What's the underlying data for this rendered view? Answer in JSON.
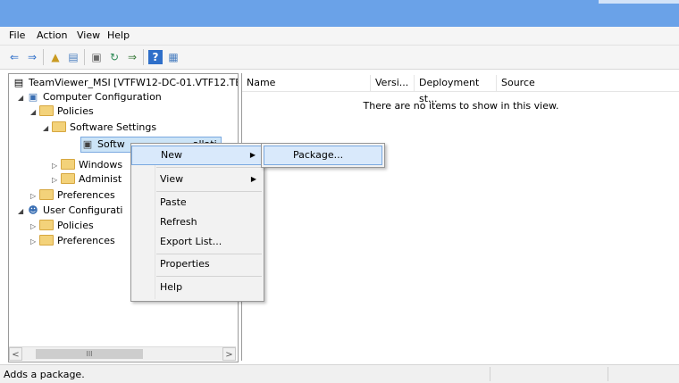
{
  "menubar": {
    "items": [
      "File",
      "Action",
      "View",
      "Help"
    ]
  },
  "toolbar": {
    "icons": [
      "back-icon",
      "forward-icon",
      "up-folder-icon",
      "show-hide-tree-icon",
      "properties-icon",
      "refresh-icon",
      "export-list-icon",
      "help-icon",
      "console-icon"
    ]
  },
  "tree": {
    "root": "TeamViewer_MSI [VTFW12-DC-01.VTF12.TE",
    "computer_config": "Computer Configuration",
    "policies": "Policies",
    "software_settings": "Software Settings",
    "software_installation": "Softw",
    "software_installation_tail": "allati",
    "windows_settings": "Windows",
    "admin_templates": "Administ",
    "preferences": "Preferences",
    "user_config": "User Configurati",
    "user_policies": "Policies",
    "user_preferences": "Preferences"
  },
  "scrollbar": {
    "thumb_grip": "III",
    "left_arrow": "<",
    "right_arrow": ">"
  },
  "list": {
    "columns": [
      "Name",
      "Versi...",
      "Deployment st...",
      "Source"
    ],
    "empty_message": "There are no items to show in this view."
  },
  "context_menu": {
    "items": [
      "New",
      "View",
      "Paste",
      "Refresh",
      "Export List...",
      "Properties",
      "Help"
    ],
    "submenu_marker": "▶"
  },
  "submenu": {
    "items": [
      "Package..."
    ]
  },
  "status": {
    "text": "Adds a package."
  },
  "colors": {
    "titlebar": "#6aa2e8",
    "highlight": "#d9e9fb",
    "highlight_border": "#7aa9e0"
  }
}
